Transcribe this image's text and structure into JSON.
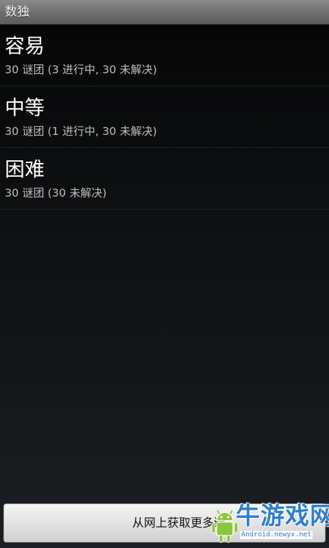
{
  "app": {
    "title": "数独"
  },
  "difficulty_list": [
    {
      "title": "容易",
      "summary": "30 谜团 (3 进行中, 30 未解决)"
    },
    {
      "title": "中等",
      "summary": "30 谜团 (1 进行中, 30 未解决)"
    },
    {
      "title": "困难",
      "summary": "30 谜团 (30 未解决)"
    }
  ],
  "footer": {
    "get_more_label": "从网上获取更多谜"
  },
  "watermark": {
    "brand": "牛游戏网",
    "url": "Android.newyx.net"
  },
  "colors": {
    "title_bar": "#6e6e6e",
    "background": "#101214",
    "watermark_blue": "#2f7fd0",
    "android_green": "#8cc63f"
  }
}
